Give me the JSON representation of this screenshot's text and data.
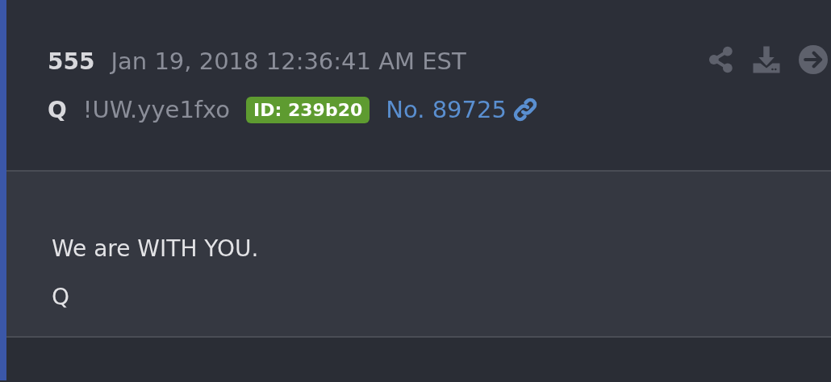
{
  "post": {
    "number": "555",
    "timestamp": "Jan 19, 2018 12:36:41 AM EST",
    "author": "Q",
    "tripcode": "!UW.yye1fxo",
    "id_badge": "ID: 239b20",
    "post_link": "No. 89725",
    "body_lines": [
      "We are WITH YOU.",
      "Q"
    ]
  }
}
